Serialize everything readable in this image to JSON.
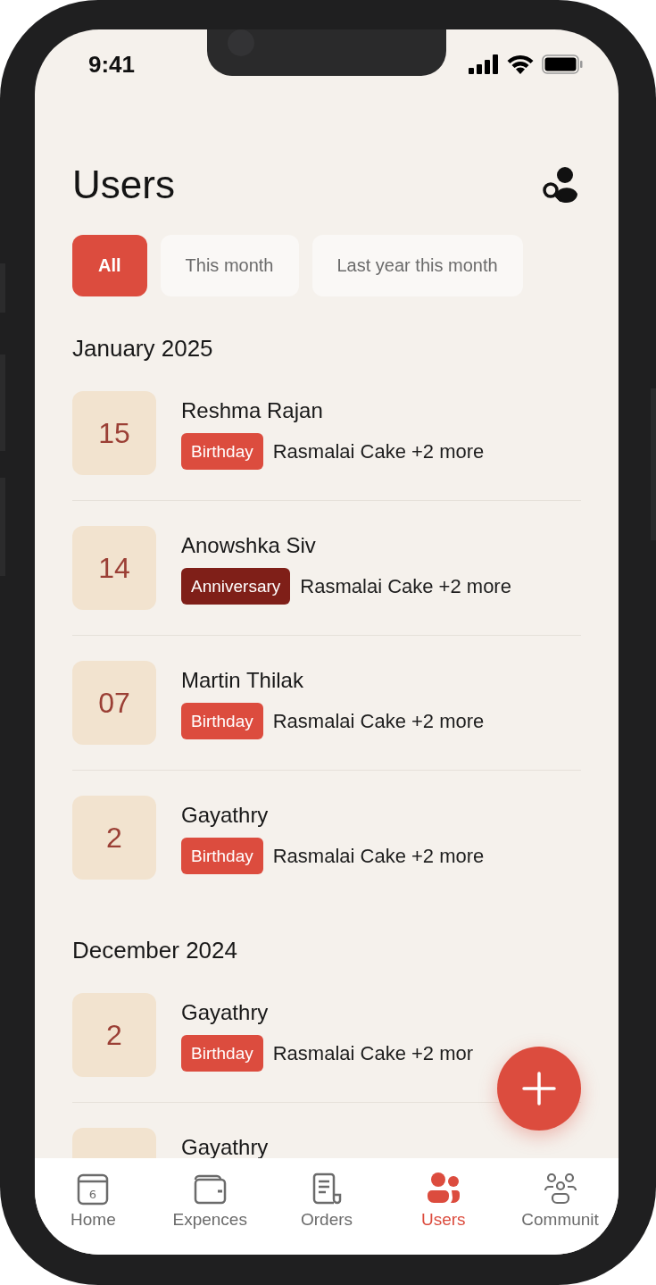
{
  "status_bar": {
    "time": "9:41"
  },
  "header": {
    "title": "Users"
  },
  "filters": [
    {
      "label": "All",
      "selected": true
    },
    {
      "label": "This month",
      "selected": false
    },
    {
      "label": "Last year this month",
      "selected": false
    }
  ],
  "sections": [
    {
      "title": "January 2025",
      "rows": [
        {
          "day": "15",
          "name": "Reshma Rajan",
          "tag": {
            "label": "Birthday",
            "color": "#dc4c3e"
          },
          "items": "Rasmalai Cake +2 more"
        },
        {
          "day": "14",
          "name": "Anowshka Siv",
          "tag": {
            "label": "Anniversary",
            "color": "#7f1f18"
          },
          "items": "Rasmalai Cake +2 more"
        },
        {
          "day": "07",
          "name": "Martin Thilak",
          "tag": {
            "label": "Birthday",
            "color": "#dc4c3e"
          },
          "items": "Rasmalai Cake +2 more"
        },
        {
          "day": "2",
          "name": "Gayathry",
          "tag": {
            "label": "Birthday",
            "color": "#dc4c3e"
          },
          "items": "Rasmalai Cake +2 more"
        }
      ]
    },
    {
      "title": "December 2024",
      "rows": [
        {
          "day": "2",
          "name": "Gayathry",
          "tag": {
            "label": "Birthday",
            "color": "#dc4c3e"
          },
          "items": "Rasmalai Cake +2 mor"
        },
        {
          "name": "Gayathry"
        }
      ]
    }
  ],
  "nav": [
    {
      "kind": "calendar",
      "label": "Home",
      "icon_text": "6",
      "selected": false
    },
    {
      "kind": "wallet",
      "label": "Expences",
      "selected": false
    },
    {
      "kind": "receipt",
      "label": "Orders",
      "selected": false
    },
    {
      "kind": "users",
      "label": "Users",
      "selected": true
    },
    {
      "kind": "community",
      "label": "Communit",
      "selected": false
    }
  ]
}
